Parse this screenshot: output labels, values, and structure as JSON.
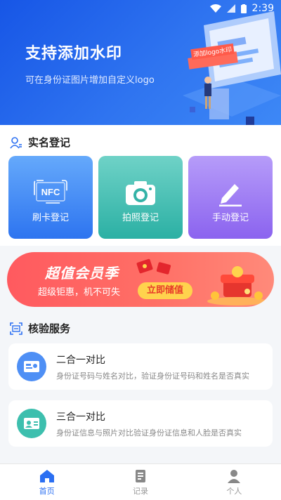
{
  "status": {
    "time": "2:39"
  },
  "hero": {
    "title": "支持添加水印",
    "subtitle": "可在身份证图片增加自定义logo",
    "illustration_caption": "添加logo水印"
  },
  "realname": {
    "heading": "实名登记",
    "tiles": [
      {
        "label": "刷卡登记",
        "icon": "nfc-icon",
        "icon_text": "NFC"
      },
      {
        "label": "拍照登记",
        "icon": "camera-icon"
      },
      {
        "label": "手动登记",
        "icon": "pencil-icon"
      }
    ]
  },
  "banner": {
    "title": "超值会员季",
    "subtitle": "超级钜惠，机不可失",
    "button": "立即储值"
  },
  "verify": {
    "heading": "核验服务",
    "cards": [
      {
        "title": "二合一对比",
        "desc": "身份证号码与姓名对比，验证身份证号码和姓名是否真实",
        "color": "#4e8ff5"
      },
      {
        "title": "三合一对比",
        "desc": "身份证信息与照片对比验证身份证信息和人脸是否真实",
        "color": "#3dbfae"
      }
    ]
  },
  "tabbar": {
    "items": [
      {
        "label": "首页",
        "active": true
      },
      {
        "label": "记录",
        "active": false
      },
      {
        "label": "个人",
        "active": false
      }
    ]
  },
  "colors": {
    "primary": "#2b6ff2",
    "banner": "#ff5a5f",
    "button_yellow": "#ffd34d"
  }
}
